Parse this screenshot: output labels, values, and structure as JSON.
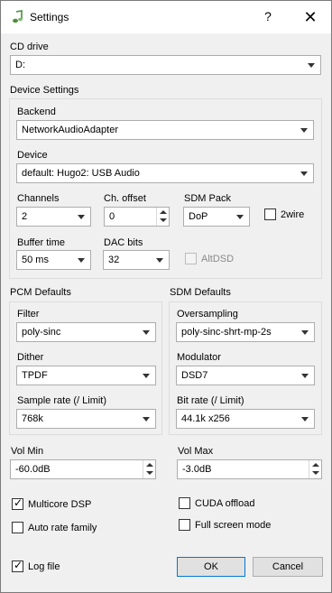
{
  "window": {
    "title": "Settings",
    "help": "?",
    "close": "✕"
  },
  "cd_drive": {
    "label": "CD drive",
    "value": "D:"
  },
  "device_settings": {
    "title": "Device Settings",
    "backend": {
      "label": "Backend",
      "value": "NetworkAudioAdapter"
    },
    "device": {
      "label": "Device",
      "value": "default: Hugo2: USB Audio"
    },
    "channels": {
      "label": "Channels",
      "value": "2"
    },
    "ch_offset": {
      "label": "Ch. offset",
      "value": "0"
    },
    "sdm_pack": {
      "label": "SDM Pack",
      "value": "DoP"
    },
    "two_wire": {
      "label": "2wire",
      "checked": false
    },
    "buffer_time": {
      "label": "Buffer time",
      "value": "50 ms"
    },
    "dac_bits": {
      "label": "DAC bits",
      "value": "32"
    },
    "altdsd": {
      "label": "AltDSD",
      "checked": false,
      "enabled": false
    }
  },
  "pcm_defaults": {
    "title": "PCM Defaults",
    "filter": {
      "label": "Filter",
      "value": "poly-sinc"
    },
    "dither": {
      "label": "Dither",
      "value": "TPDF"
    },
    "sample_rate": {
      "label": "Sample rate (/ Limit)",
      "value": "768k"
    }
  },
  "sdm_defaults": {
    "title": "SDM Defaults",
    "oversampling": {
      "label": "Oversampling",
      "value": "poly-sinc-shrt-mp-2s"
    },
    "modulator": {
      "label": "Modulator",
      "value": "DSD7"
    },
    "bit_rate": {
      "label": "Bit rate (/ Limit)",
      "value": "44.1k x256"
    }
  },
  "vol_min": {
    "label": "Vol Min",
    "value": "-60.0dB"
  },
  "vol_max": {
    "label": "Vol Max",
    "value": "-3.0dB"
  },
  "multicore_dsp": {
    "label": "Multicore DSP",
    "checked": true
  },
  "cuda_offload": {
    "label": "CUDA offload",
    "checked": false
  },
  "auto_rate_family": {
    "label": "Auto rate family",
    "checked": false
  },
  "full_screen_mode": {
    "label": "Full screen mode",
    "checked": false
  },
  "log_file": {
    "label": "Log file",
    "checked": true
  },
  "buttons": {
    "ok": "OK",
    "cancel": "Cancel"
  }
}
